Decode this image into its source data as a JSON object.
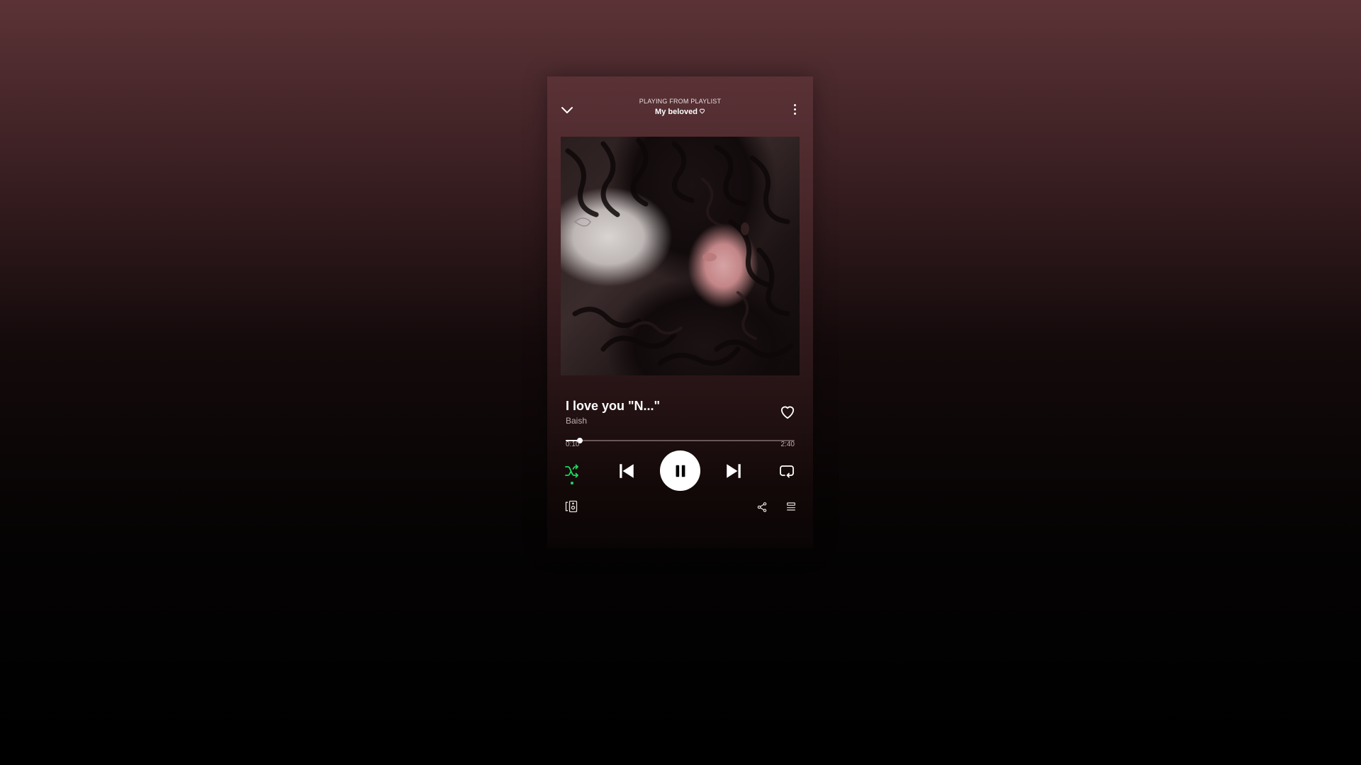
{
  "header": {
    "source_label": "PLAYING FROM PLAYLIST",
    "playlist_name": "My beloved",
    "collapse_icon": "chevron-down-icon",
    "more_icon": "more-vertical-icon"
  },
  "artwork": {
    "description_icon": "album-art-image"
  },
  "track": {
    "title": "I love you \"N...\"",
    "artist": "Baish",
    "liked": false
  },
  "playback": {
    "elapsed": "0:10",
    "total": "2:40",
    "progress": 0.0625,
    "is_playing": true,
    "shuffle_on": true,
    "repeat_on": false
  },
  "colors": {
    "accent": "#1ed760",
    "text_primary": "#ffffff",
    "text_secondary": "#bfaeae",
    "background_top": "#5a3236"
  },
  "bottom_bar": {
    "devices_icon": "connect-device-icon",
    "share_icon": "share-icon",
    "queue_icon": "queue-icon"
  }
}
